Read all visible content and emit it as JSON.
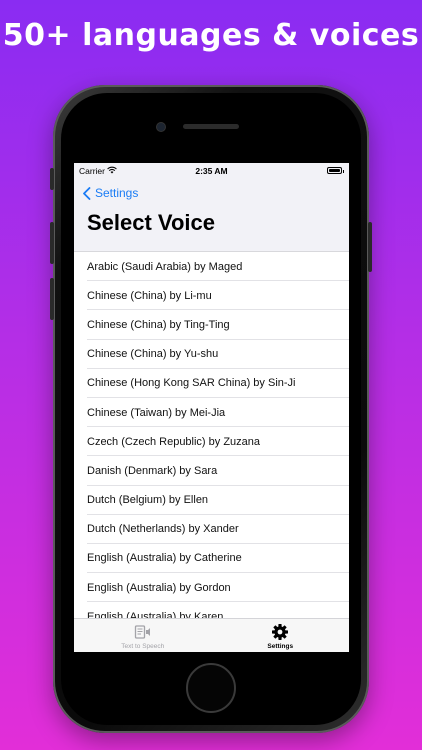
{
  "headline": "50+ languages & voices",
  "status_bar": {
    "carrier": "Carrier",
    "time": "2:35 AM"
  },
  "nav": {
    "back_label": "Settings",
    "title": "Select Voice"
  },
  "voices": [
    "Arabic (Saudi Arabia) by Maged",
    "Chinese (China) by Li-mu",
    "Chinese (China) by Ting-Ting",
    "Chinese (China) by Yu-shu",
    "Chinese (Hong Kong SAR China) by Sin-Ji",
    "Chinese (Taiwan) by Mei-Jia",
    "Czech (Czech Republic) by Zuzana",
    "Danish (Denmark) by Sara",
    "Dutch (Belgium) by Ellen",
    "Dutch (Netherlands) by Xander",
    "English (Australia) by Catherine",
    "English (Australia) by Gordon",
    "English (Australia) by Karen"
  ],
  "tabs": [
    {
      "label": "Text to Speech",
      "icon": "text-to-speech-icon",
      "active": false
    },
    {
      "label": "Settings",
      "icon": "gear-icon",
      "active": true
    }
  ],
  "colors": {
    "accent": "#1a7cf5",
    "gradient_top": "#8a2cf2",
    "gradient_bottom": "#e22ed8"
  }
}
